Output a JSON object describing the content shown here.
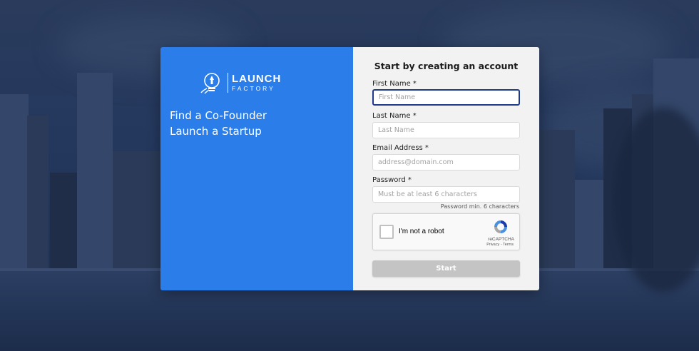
{
  "brand": {
    "logo_line1": "LAUNCH",
    "logo_line2": "FACTORY",
    "tagline_line1": "Find a Co-Founder",
    "tagline_line2": "Launch a Startup",
    "accent_color": "#2b7de9"
  },
  "form": {
    "title": "Start by creating an account",
    "first_name": {
      "label": "First Name *",
      "placeholder": "First Name",
      "value": ""
    },
    "last_name": {
      "label": "Last Name *",
      "placeholder": "Last Name",
      "value": ""
    },
    "email": {
      "label": "Email Address *",
      "placeholder": "address@domain.com",
      "value": ""
    },
    "password": {
      "label": "Password *",
      "placeholder": "Must be at least 6 characters",
      "value": "",
      "hint": "Password min. 6 characters"
    },
    "captcha": {
      "label": "I'm not a robot",
      "brand": "reCAPTCHA",
      "links": "Privacy - Terms",
      "checked": false
    },
    "submit_label": "Start",
    "submit_color": "#c4c4c4"
  },
  "icons": {
    "logo": "rocket-lightbulb-icon",
    "captcha": "recaptcha-icon"
  }
}
